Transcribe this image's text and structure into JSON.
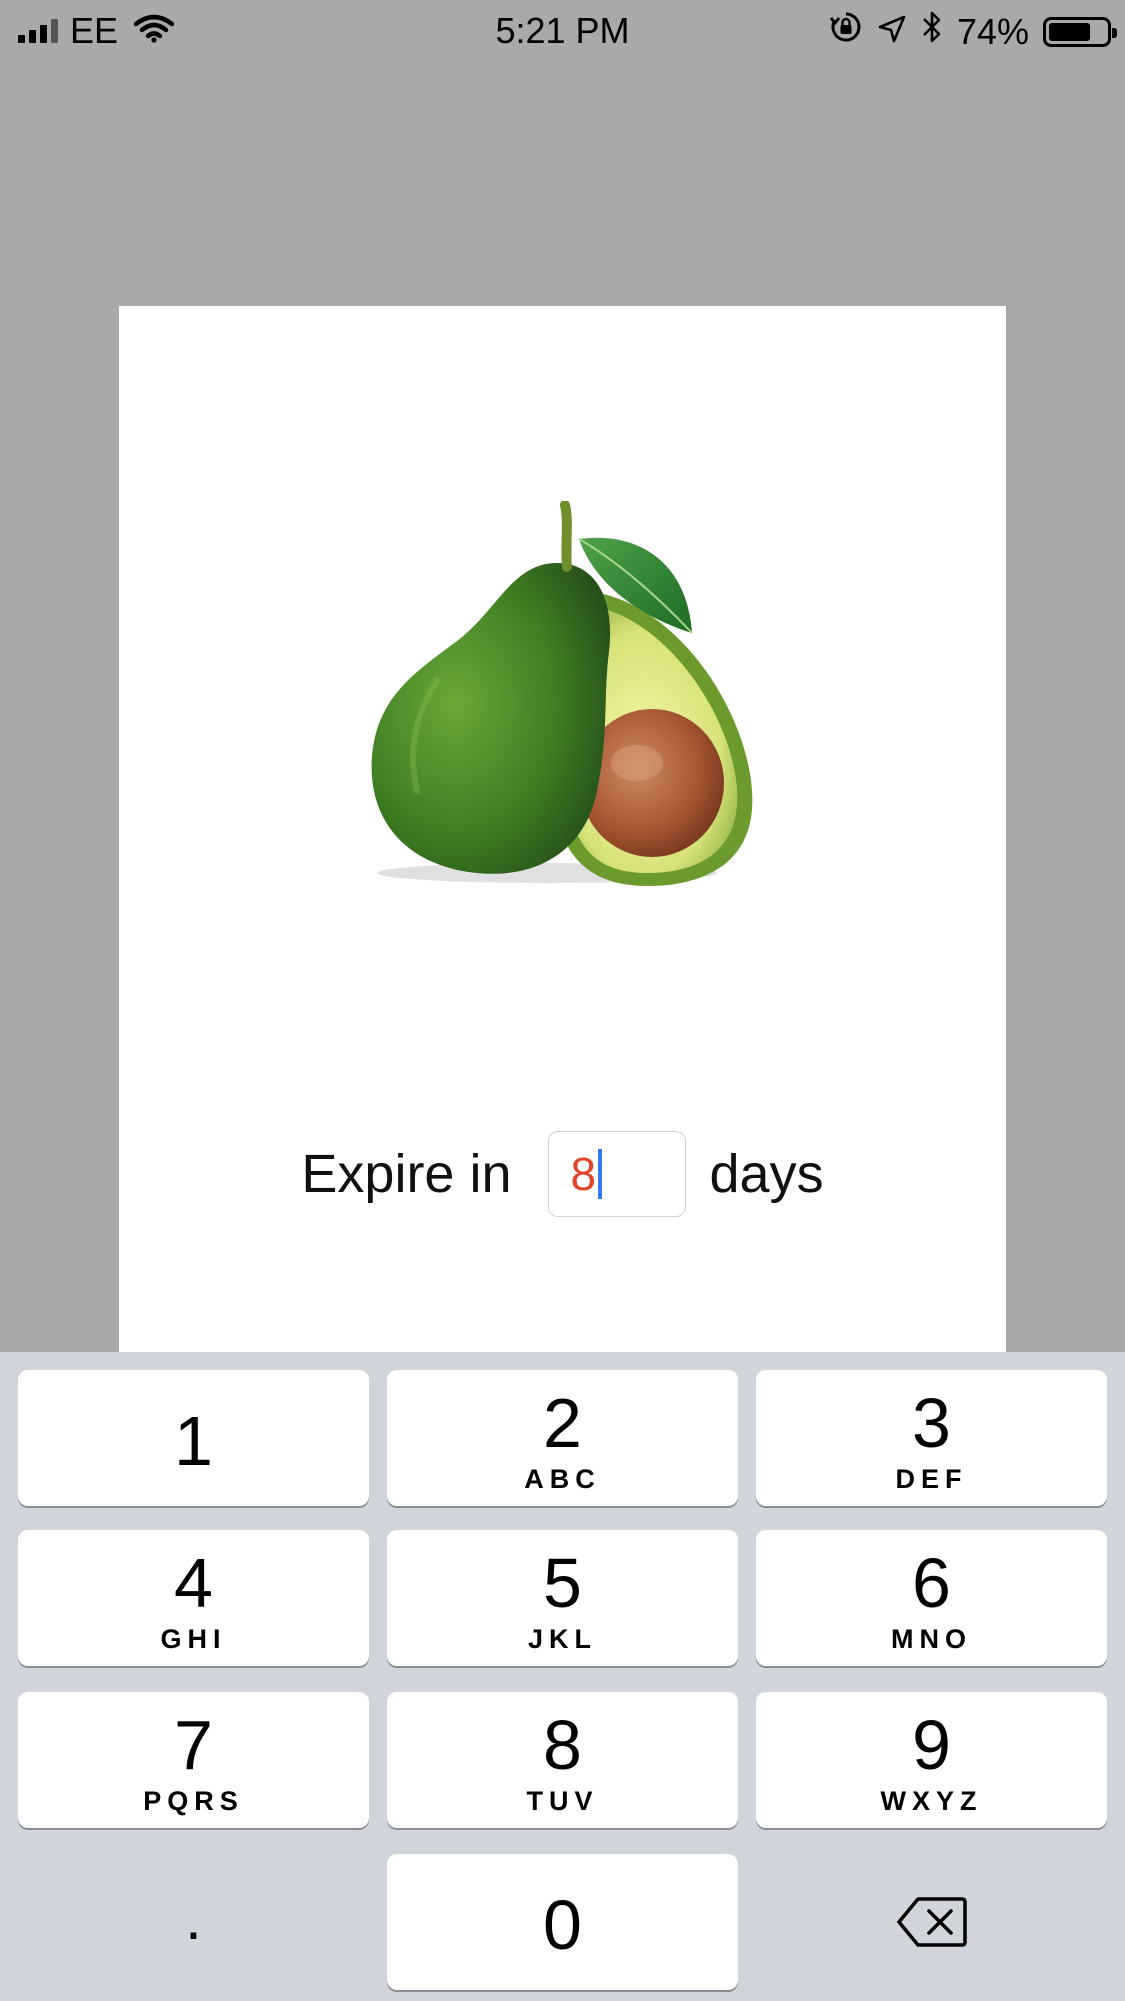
{
  "status_bar": {
    "carrier": "EE",
    "time": "5:21 PM",
    "battery_percent_label": "74%",
    "battery_level": 0.74,
    "icons": [
      "signal-icon",
      "wifi-icon",
      "rotation-lock-icon",
      "location-icon",
      "bluetooth-icon",
      "battery-icon"
    ]
  },
  "card": {
    "image_subject": "avocado",
    "expire_prefix": "Expire in",
    "expire_value": "8",
    "expire_suffix": "days"
  },
  "keypad": {
    "keys": [
      {
        "digit": "1",
        "letters": ""
      },
      {
        "digit": "2",
        "letters": "ABC"
      },
      {
        "digit": "3",
        "letters": "DEF"
      },
      {
        "digit": "4",
        "letters": "GHI"
      },
      {
        "digit": "5",
        "letters": "JKL"
      },
      {
        "digit": "6",
        "letters": "MNO"
      },
      {
        "digit": "7",
        "letters": "PQRS"
      },
      {
        "digit": "8",
        "letters": "TUV"
      },
      {
        "digit": "9",
        "letters": "WXYZ"
      },
      {
        "digit": "0",
        "letters": ""
      }
    ],
    "decimal_label": ".",
    "backspace_icon": "backspace-icon"
  },
  "colors": {
    "overlay_background": "#a9a9a9",
    "keypad_background": "#d1d5db",
    "input_text": "#e0452b",
    "caret": "#3478f6"
  }
}
